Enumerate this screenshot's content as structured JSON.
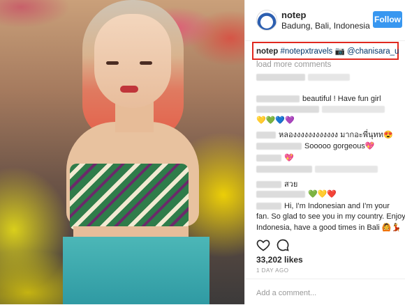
{
  "post": {
    "username": "notep",
    "location": "Badung, Bali, Indonesia",
    "follow_label": "Follow"
  },
  "caption": {
    "username": "notep",
    "hashtag": "#notepxtravels",
    "camera_emoji": "📷",
    "mention": "@chanisara_u"
  },
  "load_more": "load more comments",
  "comments": [
    {
      "text": "",
      "emoji": ""
    },
    {
      "text": "beautiful ! Have fun girl",
      "emoji": ""
    },
    {
      "text": "",
      "emoji": ""
    },
    {
      "text": "",
      "emoji": "💛💚💙💜"
    },
    {
      "text": "หลองงงงงงงงงงงง มากอะพี่นุทท",
      "emoji": "😍"
    },
    {
      "text": "Sooooo gorgeous",
      "emoji": "💖"
    },
    {
      "text": "",
      "emoji": "💖"
    },
    {
      "text": "",
      "emoji": ""
    },
    {
      "text": "สวย",
      "emoji": ""
    },
    {
      "text": "",
      "emoji": "💚💛❤️"
    },
    {
      "text": "Hi, I'm Indonesian and I'm your",
      "emoji": ""
    },
    {
      "text": "fan. So glad to see you in my country. Enjoy",
      "emoji": ""
    },
    {
      "text": "Indonesia, have a good times in Bali",
      "emoji": "🙆💃"
    }
  ],
  "likes": "33,202 likes",
  "timestamp": "1 DAY AGO",
  "add_comment_placeholder": "Add a comment...",
  "colors": {
    "accent": "#3897f0",
    "highlight_box": "#e0281f",
    "hashtag": "#003569"
  },
  "icons": [
    "heart-icon",
    "comment-icon"
  ]
}
